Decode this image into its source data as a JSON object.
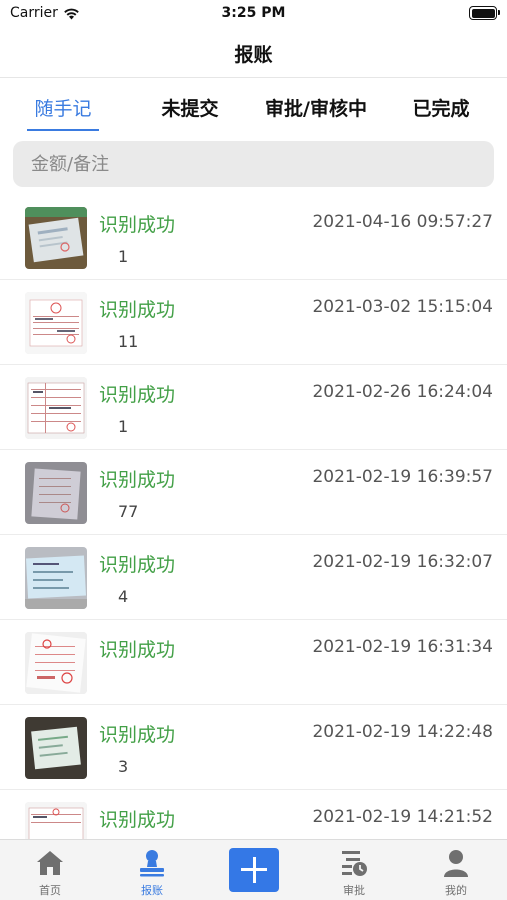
{
  "status_bar": {
    "carrier": "Carrier",
    "time": "3:25 PM"
  },
  "nav": {
    "title": "报账"
  },
  "tabs": [
    {
      "label": "随手记",
      "active": true
    },
    {
      "label": "未提交",
      "active": false
    },
    {
      "label": "审批/审核中",
      "active": false
    },
    {
      "label": "已完成",
      "active": false
    }
  ],
  "search": {
    "placeholder": "金额/备注",
    "value": ""
  },
  "records": [
    {
      "status": "识别成功",
      "count": "1",
      "timestamp": "2021-04-16 09:57:27"
    },
    {
      "status": "识别成功",
      "count": "11",
      "timestamp": "2021-03-02 15:15:04"
    },
    {
      "status": "识别成功",
      "count": "1",
      "timestamp": "2021-02-26 16:24:04"
    },
    {
      "status": "识别成功",
      "count": "77",
      "timestamp": "2021-02-19 16:39:57"
    },
    {
      "status": "识别成功",
      "count": "4",
      "timestamp": "2021-02-19 16:32:07"
    },
    {
      "status": "识别成功",
      "count": "",
      "timestamp": "2021-02-19 16:31:34"
    },
    {
      "status": "识别成功",
      "count": "3",
      "timestamp": "2021-02-19 14:22:48"
    },
    {
      "status": "识别成功",
      "count": "",
      "timestamp": "2021-02-19 14:21:52"
    }
  ],
  "tabbar": [
    {
      "label": "首页",
      "icon": "home-icon",
      "active": false
    },
    {
      "label": "报账",
      "icon": "user-stamp-icon",
      "active": true
    },
    {
      "label": "",
      "icon": "plus-icon",
      "active": false
    },
    {
      "label": "审批",
      "icon": "approval-clock-icon",
      "active": false
    },
    {
      "label": "我的",
      "icon": "person-icon",
      "active": false
    }
  ],
  "colors": {
    "accent": "#3a7be0",
    "success": "#43a047",
    "add_button": "#3478e6"
  }
}
